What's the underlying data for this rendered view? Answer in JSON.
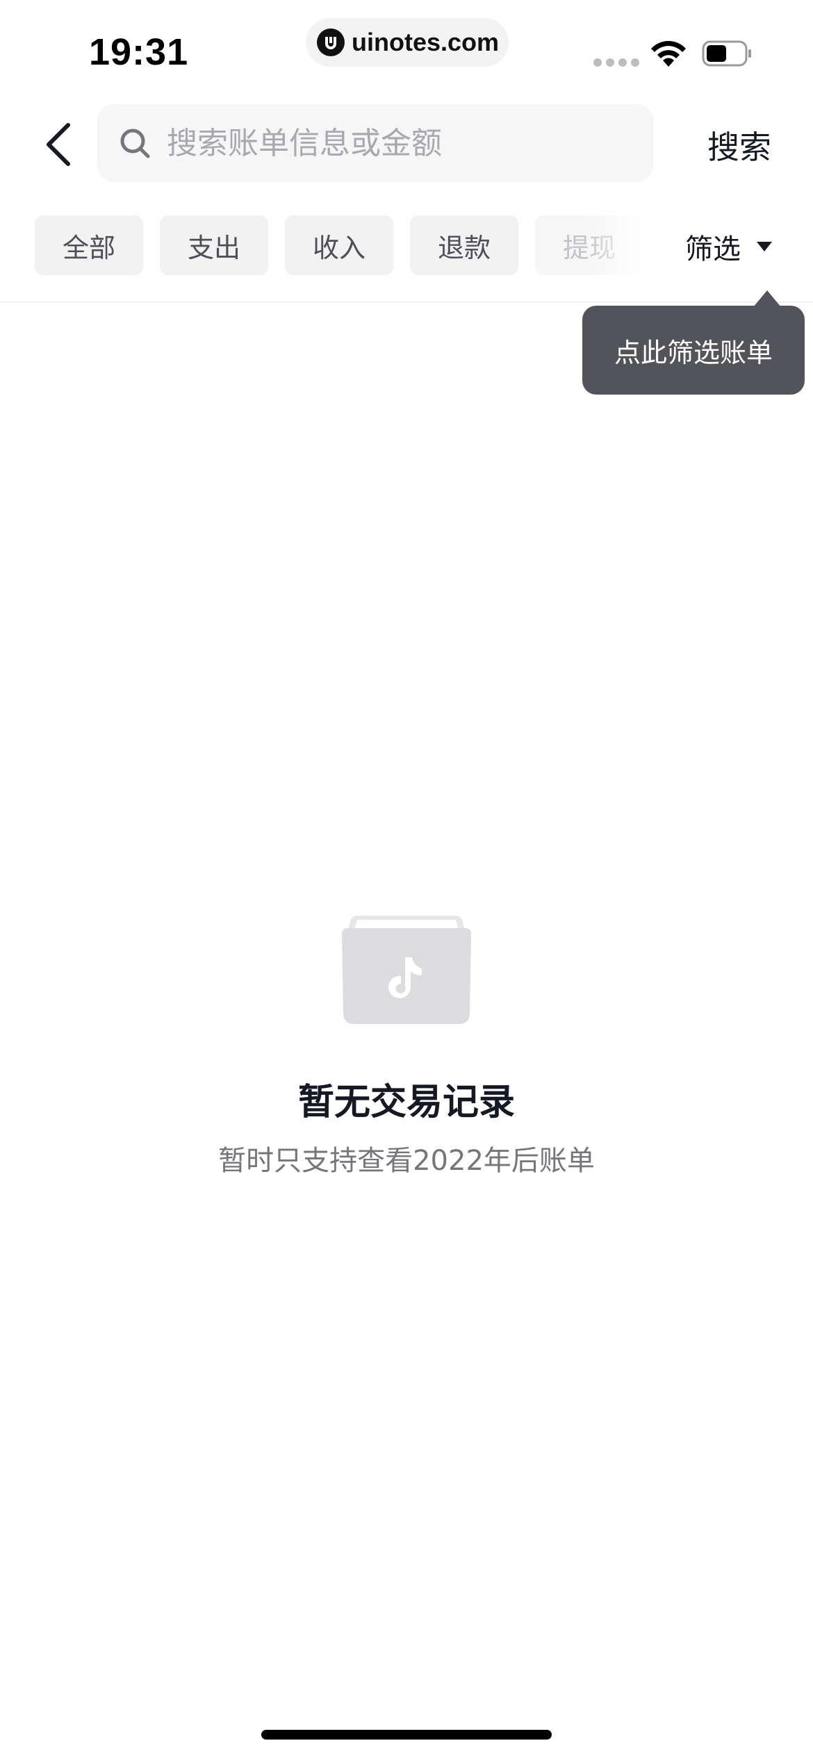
{
  "status_bar": {
    "time": "19:31",
    "url": "uinotes.com",
    "icons": [
      "cellular-signal-icon",
      "wifi-icon",
      "battery-icon"
    ]
  },
  "header": {
    "back_icon": "chevron-left-icon",
    "search_icon": "search-icon",
    "search_placeholder": "搜索账单信息或金额",
    "search_value": "",
    "search_button": "搜索"
  },
  "tabs": [
    {
      "label": "全部"
    },
    {
      "label": "支出"
    },
    {
      "label": "收入"
    },
    {
      "label": "退款"
    },
    {
      "label": "提现"
    }
  ],
  "filter": {
    "label": "筛选",
    "icon": "caret-down-icon",
    "tooltip": "点此筛选账单"
  },
  "empty_state": {
    "icon": "empty-box-tiktok-icon",
    "title": "暂无交易记录",
    "subtitle": "暂时只支持查看2022年后账单"
  },
  "colors": {
    "text_primary": "#161823",
    "text_secondary": "#75767c",
    "tab_bg": "#f2f2f3",
    "tooltip_bg": "#53545a",
    "placeholder": "#a8a9ae"
  }
}
